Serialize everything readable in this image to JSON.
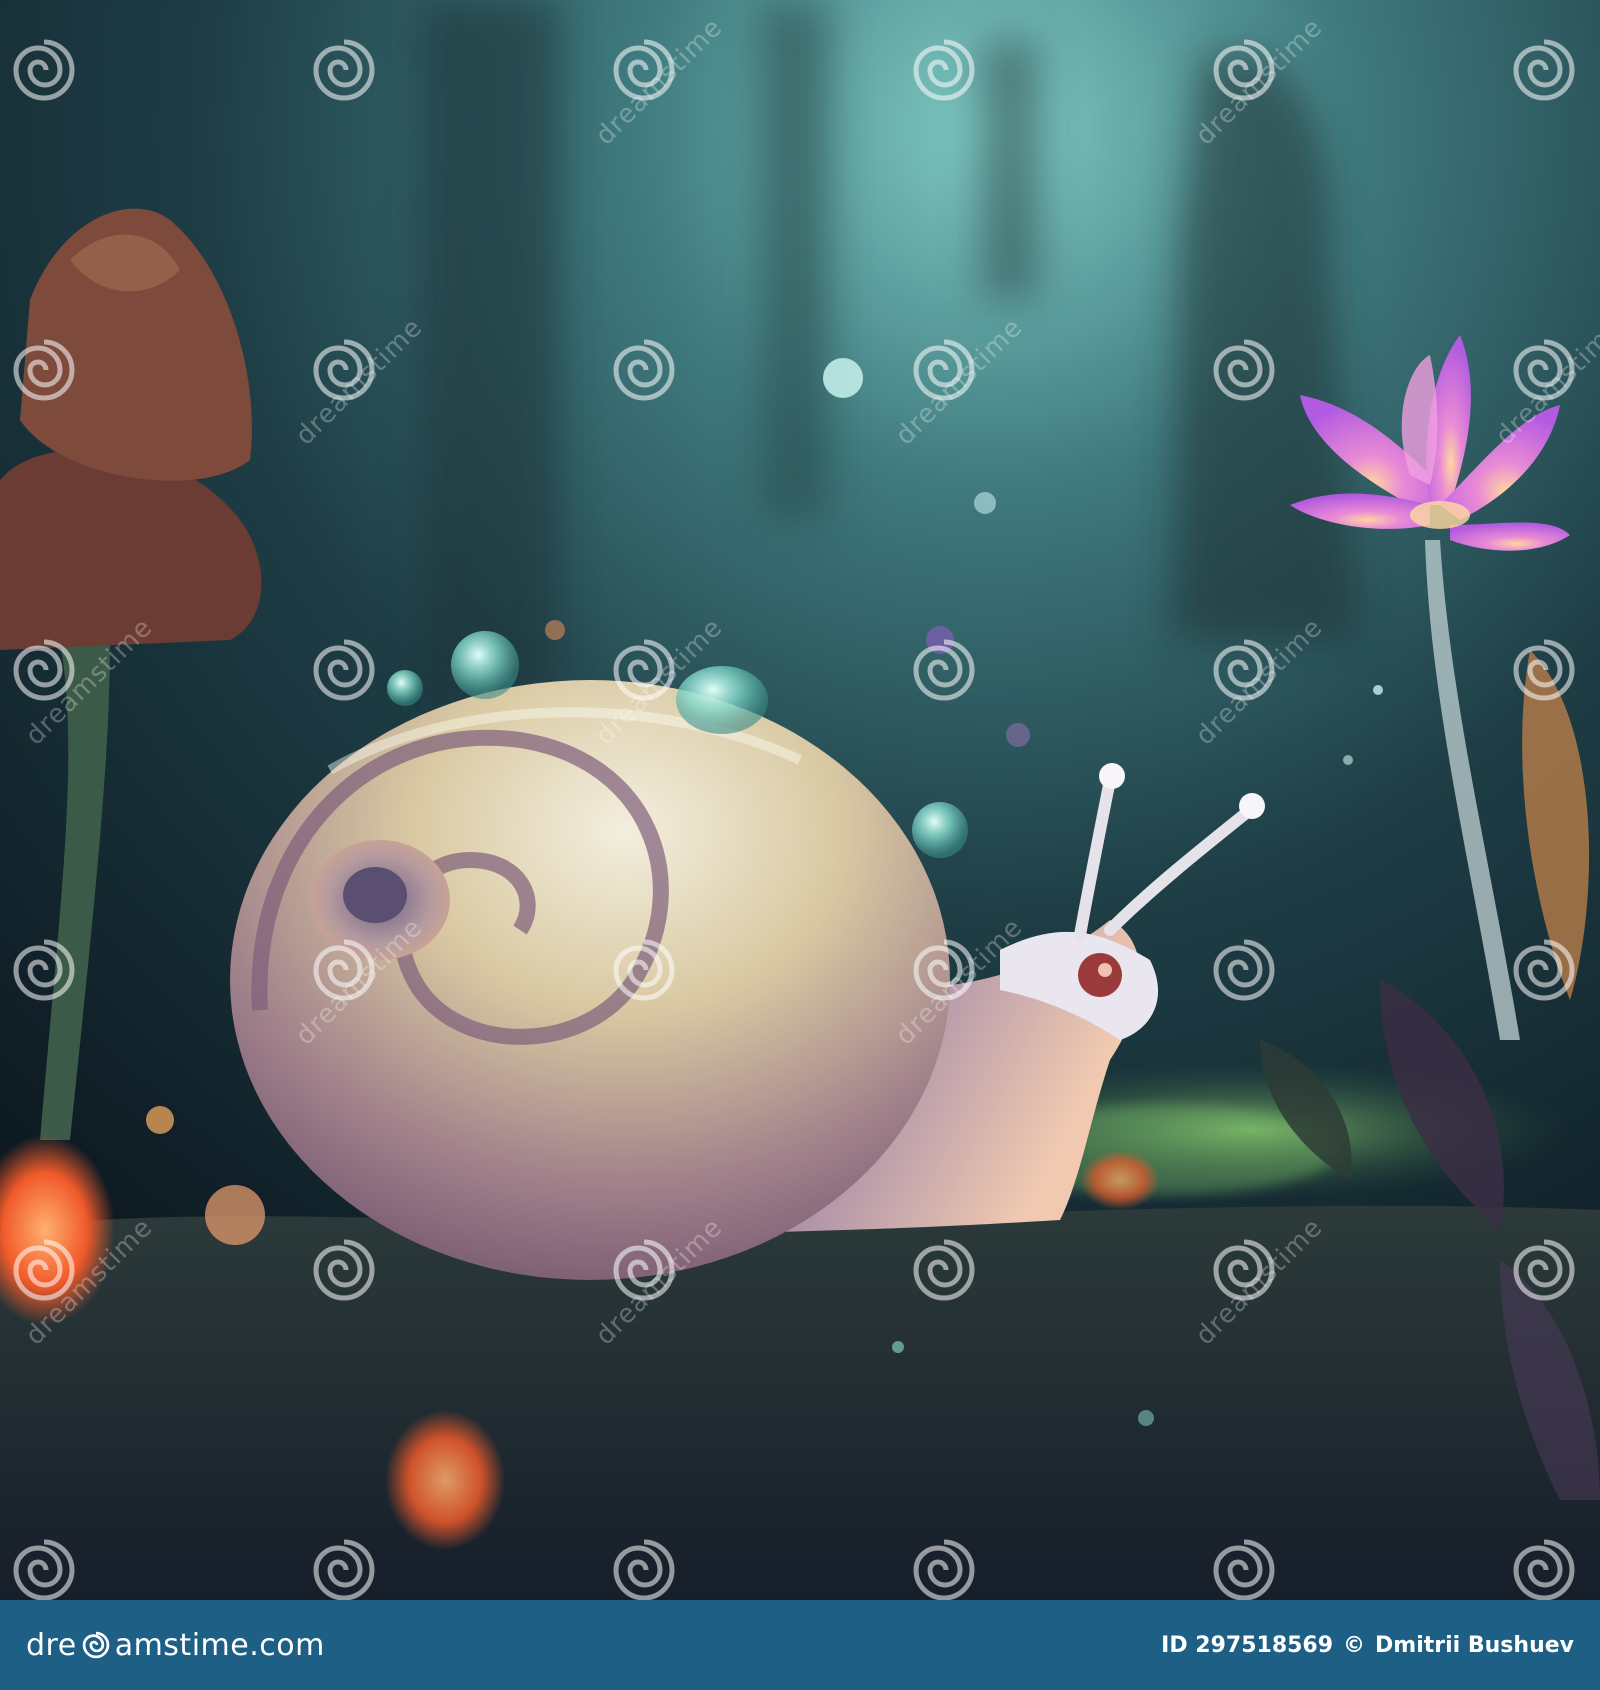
{
  "watermark": {
    "text": "dreamstime"
  },
  "footer": {
    "brand_prefix": "dre",
    "brand_suffix": "amstime.com",
    "image_id": "ID 297518569",
    "copyright_symbol": "©",
    "author": "Dmitrii Bushuev"
  },
  "colors": {
    "footer_background": "#1e5f86",
    "flower": "#d86ad8",
    "glow": "#8fe0d8"
  },
  "icons": {
    "watermark_logo": "swirl-icon"
  }
}
